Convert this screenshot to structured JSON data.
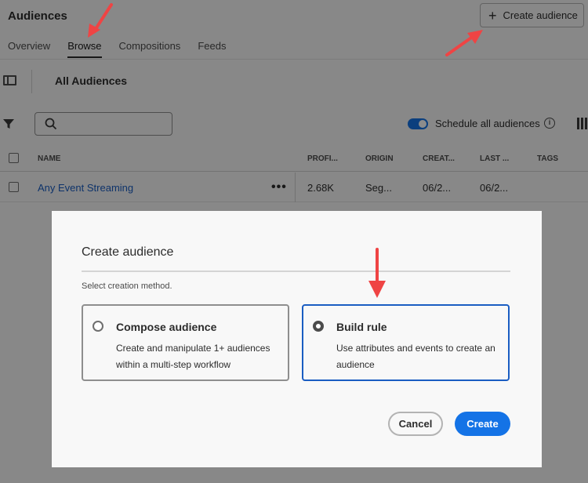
{
  "header": {
    "title": "Audiences",
    "tabs": [
      {
        "label": "Overview"
      },
      {
        "label": "Browse"
      },
      {
        "label": "Compositions"
      },
      {
        "label": "Feeds"
      }
    ],
    "create_button": "Create audience"
  },
  "subheader": {
    "title": "All Audiences"
  },
  "toolbar": {
    "search_placeholder": "",
    "schedule_label": "Schedule all audiences",
    "schedule_enabled": true
  },
  "table": {
    "columns": [
      "NAME",
      "PROFI...",
      "ORIGIN",
      "CREAT...",
      "LAST ...",
      "TAGS"
    ],
    "rows": [
      {
        "name": "Any Event Streaming",
        "profiles": "2.68K",
        "origin": "Seg...",
        "created": "06/2...",
        "last": "06/2...",
        "tags": ""
      }
    ]
  },
  "dialog": {
    "title": "Create audience",
    "subtitle": "Select creation method.",
    "options": [
      {
        "title": "Compose audience",
        "description": "Create and manipulate 1+ audiences within a multi-step workflow",
        "selected": false
      },
      {
        "title": "Build rule",
        "description": "Use attributes and events to create an audience",
        "selected": true
      }
    ],
    "cancel_label": "Cancel",
    "create_label": "Create"
  },
  "colors": {
    "accent": "#1473e6",
    "link": "#1a5dc2",
    "annotation_arrow": "#ef4444"
  }
}
